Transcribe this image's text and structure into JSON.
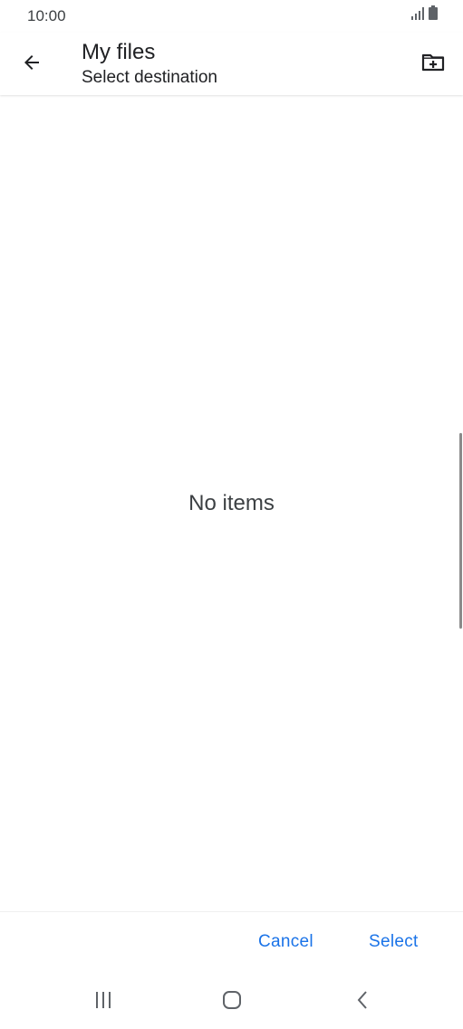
{
  "status_bar": {
    "time": "10:00",
    "icons": [
      "signal-icon",
      "battery-icon"
    ]
  },
  "app_bar": {
    "title": "My files",
    "subtitle": "Select destination",
    "icons": {
      "back": "arrow-back-icon",
      "new_folder": "create-new-folder-icon"
    }
  },
  "content": {
    "empty_message": "No items"
  },
  "actions": {
    "cancel_label": "Cancel",
    "select_label": "Select"
  },
  "navigation_bar": {
    "icons": [
      "recents-icon",
      "home-icon",
      "back-icon"
    ]
  },
  "colors": {
    "accent": "#1a73e8",
    "text_primary": "#202124",
    "text_secondary": "#3c4043",
    "background": "#ffffff"
  }
}
